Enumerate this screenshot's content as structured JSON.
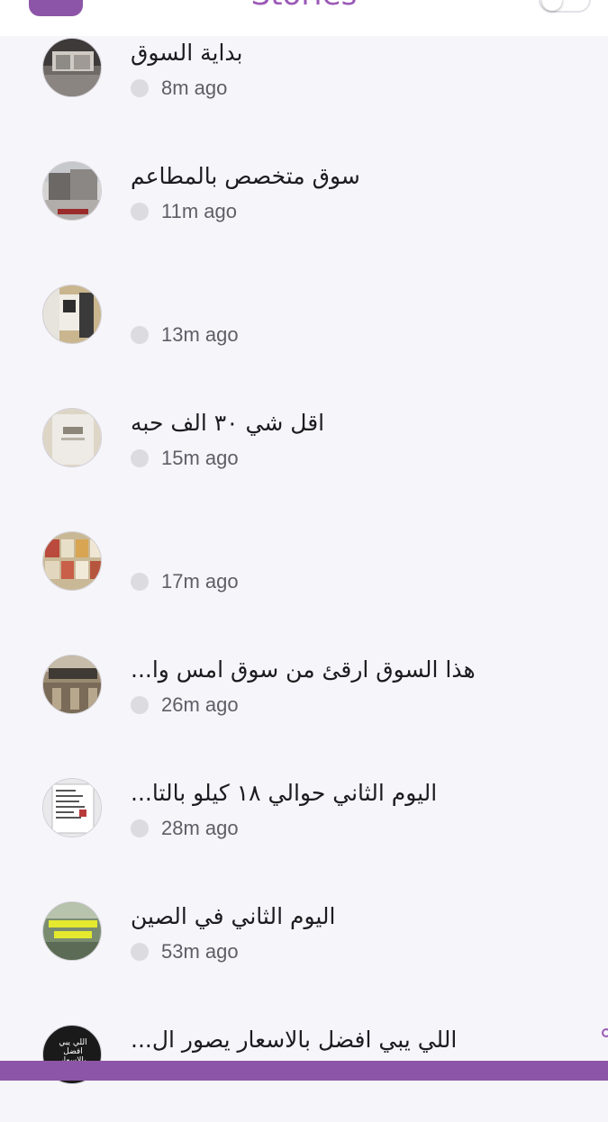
{
  "header": {
    "title": "Stories"
  },
  "colors": {
    "accent": "#8c55a8",
    "title": "#9b59b6",
    "background": "#f6f5fa"
  },
  "stories": [
    {
      "caption": "بداية السوق",
      "time": "8m ago",
      "thumb": "market-entrance-photo"
    },
    {
      "caption": "سوق متخصص بالمطاعم",
      "time": "11m ago",
      "thumb": "street-building-photo"
    },
    {
      "caption": "",
      "time": "13m ago",
      "thumb": "shelf-products-photo"
    },
    {
      "caption": "اقل شي ٣٠ الف حبه",
      "time": "15m ago",
      "thumb": "white-bag-photo"
    },
    {
      "caption": "",
      "time": "17m ago",
      "thumb": "boxes-display-photo"
    },
    {
      "caption": "هذا السوق ارقئ من سوق امس  وا...",
      "time": "26m ago",
      "thumb": "mall-sign-photo"
    },
    {
      "caption": "اليوم الثاني  حوالي ١٨ كيلو بالتا...",
      "time": "28m ago",
      "thumb": "paper-list-photo"
    },
    {
      "caption": "اليوم الثاني  في الصين",
      "time": "53m ago",
      "thumb": "text-overlay-photo"
    },
    {
      "caption": "اللي يبي افضل بالاسعار يصور ال...",
      "time": "",
      "thumb": "dark-text-photo",
      "thumb_text": "اللي يبي افضل بالاسعار"
    }
  ]
}
